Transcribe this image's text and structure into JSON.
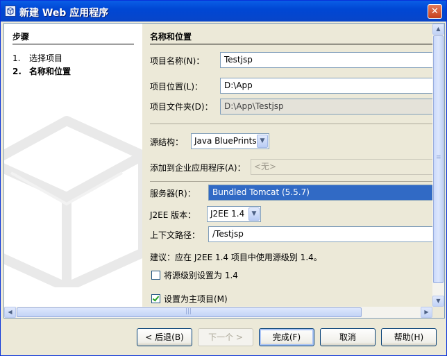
{
  "window": {
    "title": "新建 Web 应用程序",
    "close_glyph": "✕"
  },
  "steps": {
    "heading": "步骤",
    "items": [
      {
        "num": "1.",
        "label": "选择项目"
      },
      {
        "num": "2.",
        "label": "名称和位置"
      }
    ]
  },
  "panel": {
    "heading": "名称和位置",
    "project_name": {
      "label": "项目名称(N)：",
      "value": "Testjsp"
    },
    "project_location": {
      "label": "项目位置(L)：",
      "value": "D:\\App"
    },
    "project_folder": {
      "label": "项目文件夹(D)：",
      "value": "D:\\App\\Testjsp"
    },
    "source_structure": {
      "label": "源结构：",
      "value": "Java BluePrints"
    },
    "add_to_enterprise": {
      "label": "添加到企业应用程序(A)：",
      "value": "<无>"
    },
    "server": {
      "label": "服务器(R)：",
      "value": "Bundled Tomcat (5.5.7)"
    },
    "j2ee_version": {
      "label": "J2EE 版本：",
      "value": "J2EE 1.4"
    },
    "context_path": {
      "label": "上下文路径：",
      "value": "/Testjsp"
    },
    "suggestion": "建议：应在 J2EE 1.4 项目中使用源级别 1.4。",
    "set_source_level": {
      "label": "将源级别设置为 1.4",
      "checked": false
    },
    "set_main_project": {
      "label": "设置为主项目(M)",
      "checked": true
    }
  },
  "buttons": {
    "back": "< 后退(B)",
    "next": "下一个 >",
    "finish": "完成(F)",
    "cancel": "取消",
    "help": "帮助(H)"
  },
  "colors": {
    "title_bar": "#0a5ee6",
    "selection": "#316ac5",
    "dialog_bg": "#ece9d8"
  }
}
